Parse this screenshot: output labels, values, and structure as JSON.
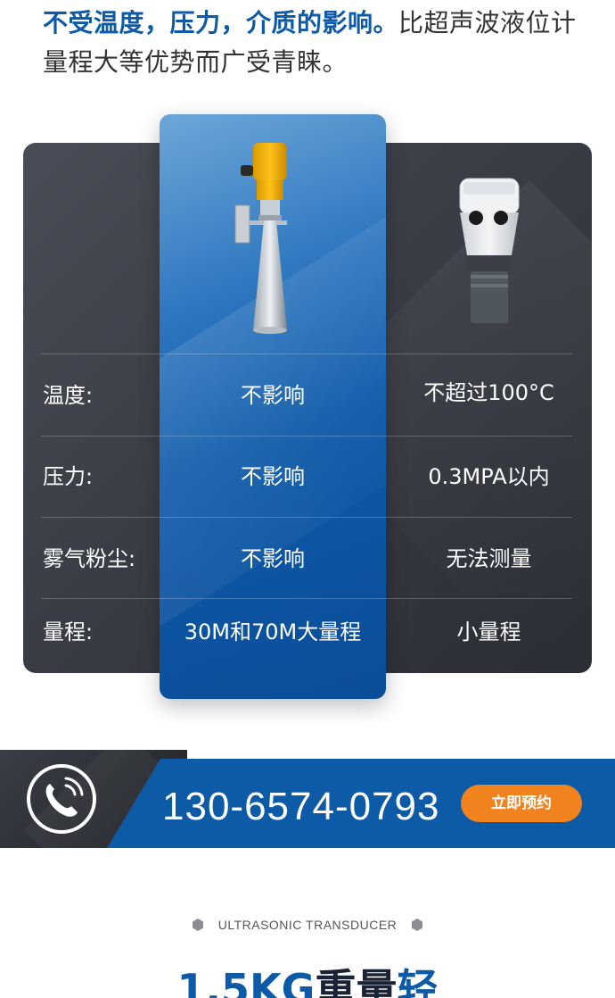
{
  "intro": {
    "highlight": "不受温度，压力，介质的影响。",
    "rest": "比超声波液位计量程大等优势而广受青睐。"
  },
  "comparison": {
    "rows": [
      {
        "label": "温度:",
        "radar": "不影响",
        "ultrasonic": "不超过100°C"
      },
      {
        "label": "压力:",
        "radar": "不影响",
        "ultrasonic": "0.3MPA以内"
      },
      {
        "label": "雾气粉尘:",
        "radar": "不影响",
        "ultrasonic": "无法测量"
      },
      {
        "label": "量程:",
        "radar": "30M和70M大量程",
        "ultrasonic": "小量程"
      }
    ]
  },
  "contact": {
    "phone": "130-6574-0793",
    "button_label": "立即预约"
  },
  "section": {
    "subtitle": "ULTRASONIC TRANSDUCER",
    "title_main": "1.5KG",
    "title_accent_dark": "重量",
    "title_accent_blue": "轻"
  },
  "colors": {
    "brand_blue": "#0d5aa7",
    "panel_dark": "#3a3d46",
    "button_orange": "#f0831e"
  }
}
